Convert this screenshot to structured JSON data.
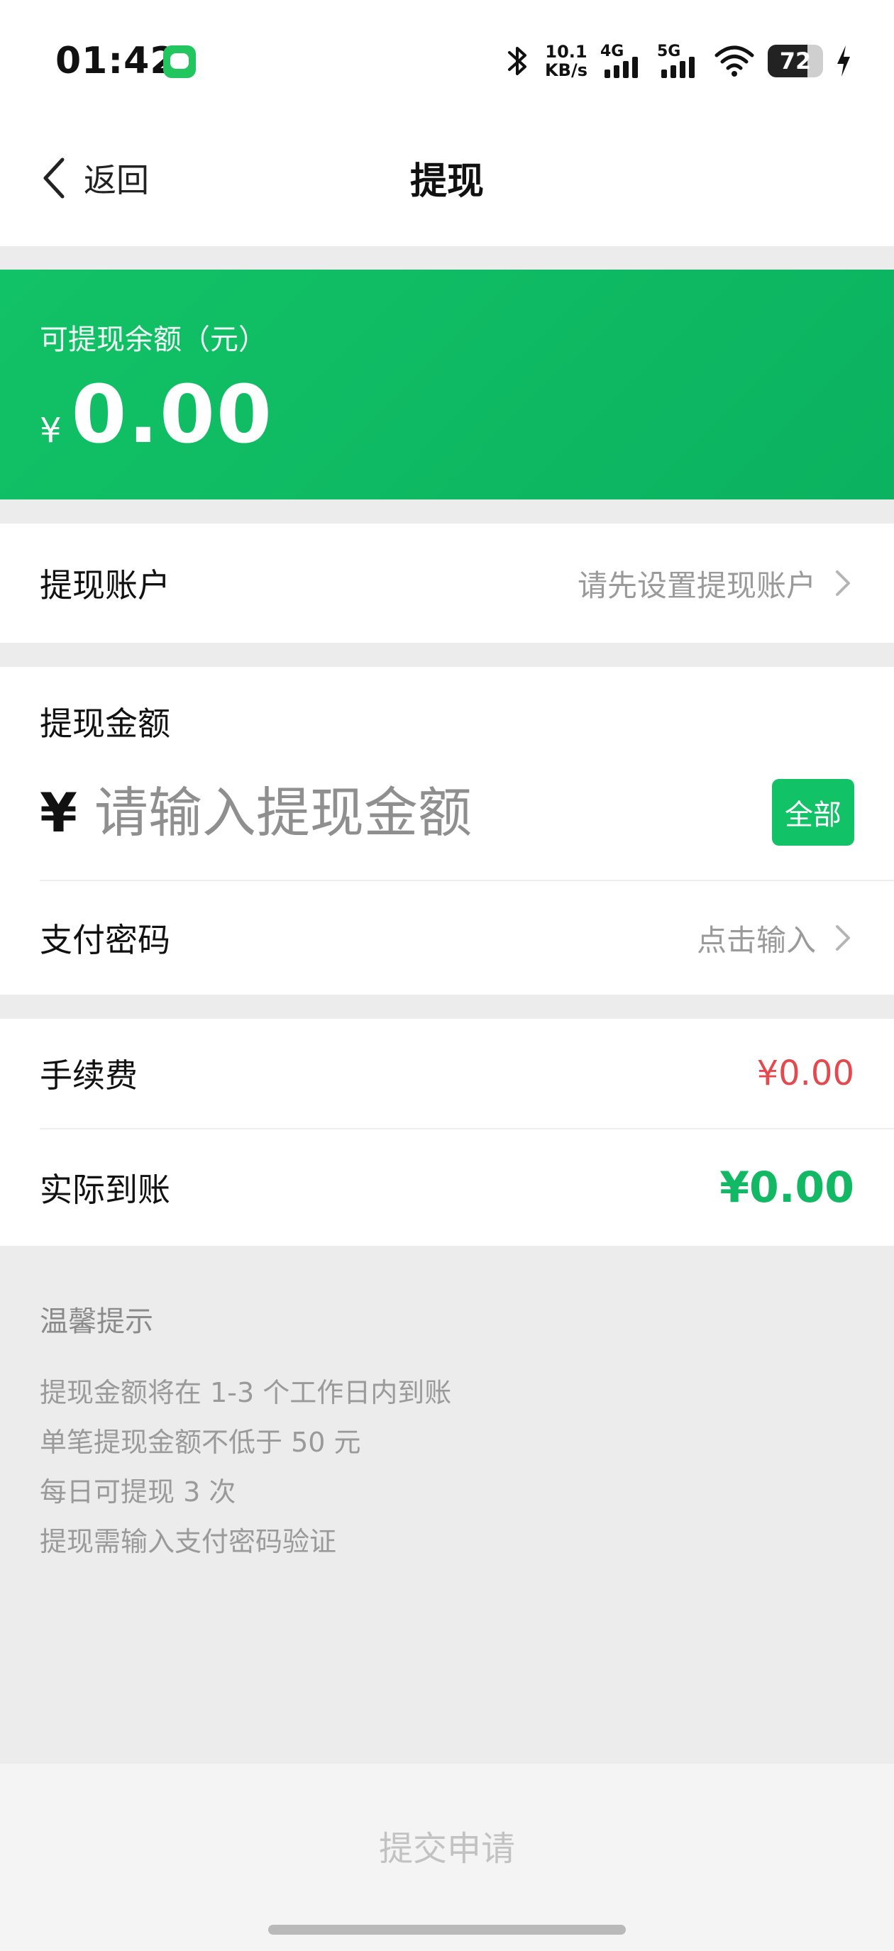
{
  "status_bar": {
    "time": "01:42",
    "net_speed_value": "10.1",
    "net_speed_unit": "KB/s",
    "signal_1_label": "4G",
    "signal_2_label": "5G",
    "battery_percent": "72",
    "battery_level": 0.72,
    "app_icon": "chat-app-icon"
  },
  "nav": {
    "back_label": "返回",
    "title": "提现"
  },
  "balance": {
    "label": "可提现余额（元）",
    "currency": "¥",
    "amount": "0.00"
  },
  "account": {
    "label": "提现账户",
    "value": "请先设置提现账户"
  },
  "withdraw": {
    "label": "提现金额",
    "currency": "¥",
    "placeholder": "请输入提现金额",
    "all_button": "全部"
  },
  "password": {
    "label": "支付密码",
    "value": "点击输入"
  },
  "fee": {
    "label": "手续费",
    "value": "¥0.00"
  },
  "actual": {
    "label": "实际到账",
    "value": "¥0.00"
  },
  "tips": {
    "title": "温馨提示",
    "items": [
      "提现金额将在 1-3 个工作日内到账",
      "单笔提现金额不低于 50 元",
      "每日可提现 3 次",
      "提现需输入支付密码验证"
    ]
  },
  "submit_label": "提交申请",
  "colors": {
    "brand_green": "#12c266",
    "fee_red": "#e5484d",
    "actual_green": "#12b863"
  }
}
